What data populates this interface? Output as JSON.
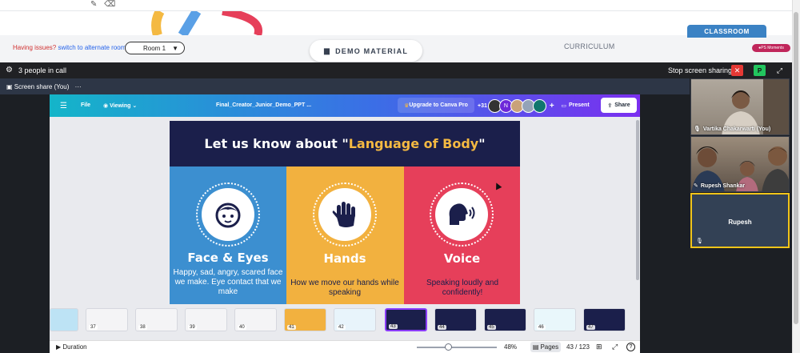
{
  "top": {
    "issues_text": "Having issues?",
    "issues_link": "switch to alternate room",
    "room_select": "Room 1",
    "demo_button": "DEMO MATERIAL",
    "curriculum_tab": "CURRICULUM",
    "classroom_tab": "CLASSROOM",
    "ps_badge": "PS Moments"
  },
  "call": {
    "people_count": "3 people in call",
    "stop_sharing": "Stop screen sharing",
    "user_badge": "P",
    "share_label": "Screen share (You)",
    "share_more": "···"
  },
  "canva": {
    "file": "File",
    "viewing": "Viewing",
    "doc_title": "Final_Creator_Junior_Demo_PPT ...",
    "upgrade": "Upgrade to Canva Pro",
    "collab_count": "+31",
    "avatar_letter": "N",
    "plus": "+",
    "present": "Present",
    "share": "Share",
    "duration": "Duration",
    "zoom": "48%",
    "pages": "Pages",
    "page_count": "43 / 123",
    "help": "?"
  },
  "slide": {
    "header_prefix": "Let us know about \"",
    "header_highlight": "Language of Body",
    "header_suffix": "\"",
    "panels": [
      {
        "title": "Face & Eyes",
        "desc": "Happy, sad, angry, scared face we make. Eye contact that we make",
        "color": "#3c8fd0"
      },
      {
        "title": "Hands",
        "desc": "How we move our hands while speaking",
        "color": "#f2b13f"
      },
      {
        "title": "Voice",
        "desc": "Speaking loudly and confidently!",
        "color": "#e63f5a"
      }
    ]
  },
  "thumbnails": [
    {
      "num": ""
    },
    {
      "num": "37"
    },
    {
      "num": "38"
    },
    {
      "num": "39"
    },
    {
      "num": "40"
    },
    {
      "num": "41"
    },
    {
      "num": "42"
    },
    {
      "num": "43"
    },
    {
      "num": "44"
    },
    {
      "num": "45"
    },
    {
      "num": "46"
    },
    {
      "num": "47"
    }
  ],
  "participants": [
    {
      "name": "Vartika Chakarwarti (You)"
    },
    {
      "name": "Rupesh Shankar"
    },
    {
      "name": "Rupesh"
    }
  ]
}
